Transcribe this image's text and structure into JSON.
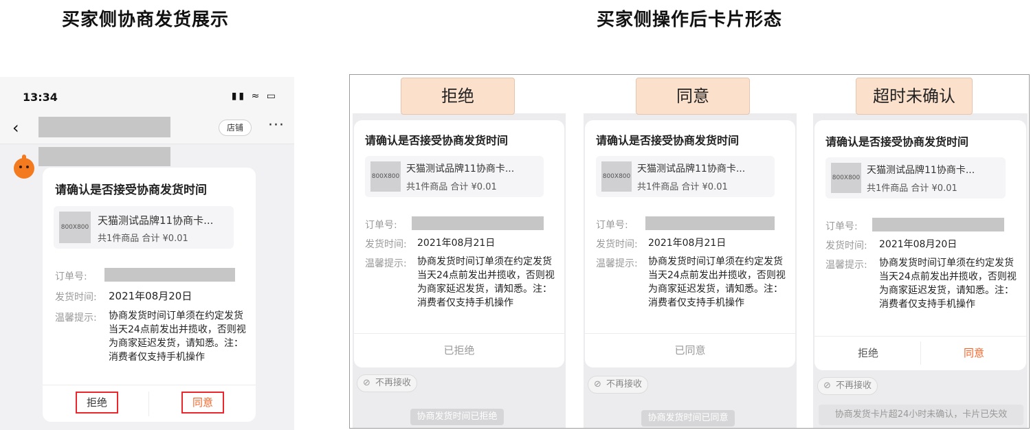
{
  "sections": {
    "left_title": "买家侧协商发货展示",
    "right_title": "买家侧操作后卡片形态"
  },
  "phone": {
    "time": "13:34",
    "status_icons": "▮▮ ≈ ▭",
    "back_glyph": "‹",
    "shop_label": "店铺",
    "more_glyph": "···"
  },
  "cards": {
    "title": "请确认是否接受协商发货时间",
    "thumb_text": "800X800",
    "product_name": "天猫测试品牌11协商卡...",
    "product_summary": "共1件商品  合计 ¥0.01",
    "order_label": "订单号:",
    "ship_label": "发货时间:",
    "tip_label": "温馨提示:",
    "tip_text": "协商发货时间订单须在约定发货当天24点前发出并揽收，否则视为商家延迟发货，请知悉。注：消费者仅支持手机操作",
    "reject_label": "拒绝",
    "agree_label": "同意",
    "no_receive_label": "不再接收",
    "no_receive_icon": "⊘"
  },
  "main_card": {
    "ship_time": "2021年08月20日"
  },
  "states": [
    {
      "tag": "拒绝",
      "ship_time": "2021年08月21日",
      "result": "已拒绝",
      "pill": "协商发货时间已拒绝"
    },
    {
      "tag": "同意",
      "ship_time": "2021年08月21日",
      "result": "已同意",
      "pill": "协商发货时间已同意"
    },
    {
      "tag": "超时未确认",
      "ship_time": "2021年08月20日",
      "reject": "拒绝",
      "agree": "同意",
      "note": "协商发货卡片超24小时未确认，卡片已失效"
    }
  ],
  "colors": {
    "accent": "#f0642a",
    "highlight": "#e8262b",
    "tag_bg": "#fbe0cc"
  }
}
